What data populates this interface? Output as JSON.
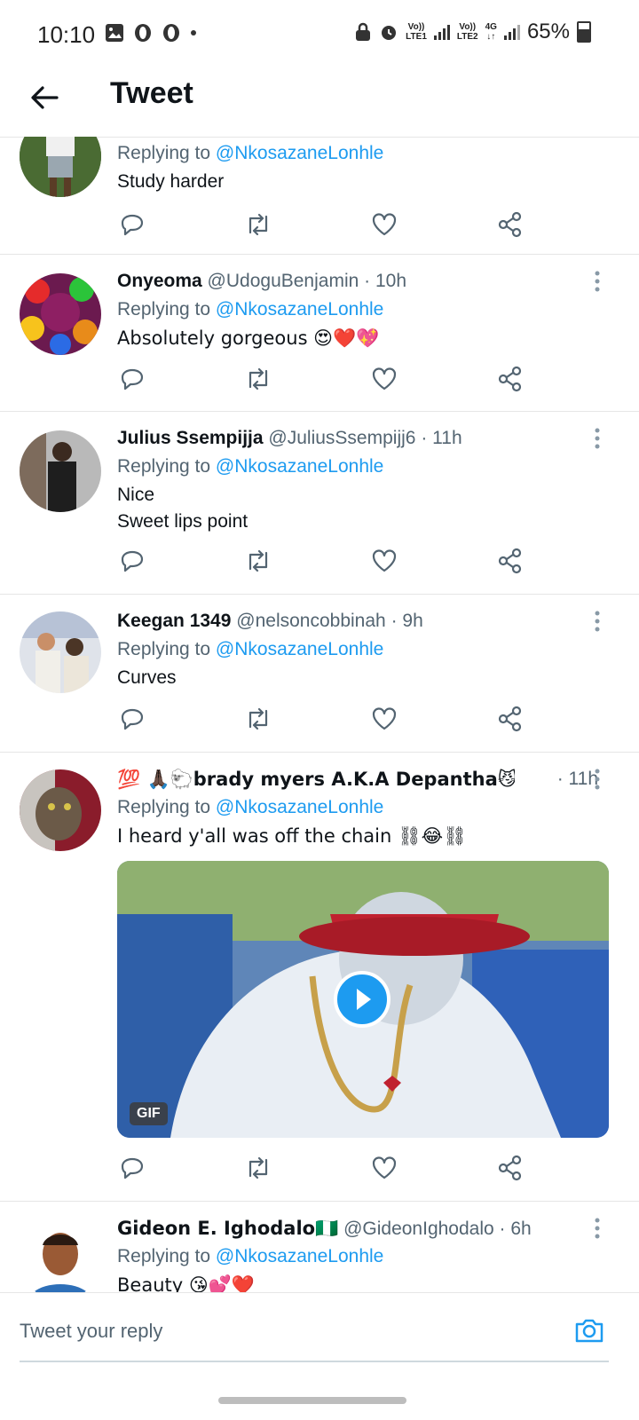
{
  "status_bar": {
    "time": "10:10",
    "net1": [
      "Vo))",
      "LTE1"
    ],
    "net2": [
      "Vo))",
      "LTE2"
    ],
    "net3": "4G",
    "battery": "65%"
  },
  "header": {
    "title": "Tweet"
  },
  "tweets": [
    {
      "name": "",
      "handle": "",
      "time": "",
      "replying_label": "Replying to",
      "replying_to": "@NkosazaneLonhle",
      "text": "Study harder"
    },
    {
      "name": "Onyeoma",
      "handle": "@UdoguBenjamin",
      "time": "· 10h",
      "replying_label": "Replying to",
      "replying_to": "@NkosazaneLonhle",
      "text": "Absolutely gorgeous 😍❤️💖"
    },
    {
      "name": "Julius Ssempijja",
      "handle": "@JuliusSsempijj6",
      "time": "· 11h",
      "replying_label": "Replying to",
      "replying_to": "@NkosazaneLonhle",
      "text": "Nice\nSweet lips point"
    },
    {
      "name": "Keegan 1349",
      "handle": "@nelsoncobbinah",
      "time": "· 9h",
      "replying_label": "Replying to",
      "replying_to": "@NkosazaneLonhle",
      "text": "Curves"
    },
    {
      "name": "💯 🙏🏿🐑brady myers A.K.A Depantha😼♠️...",
      "handle": "",
      "time": "· 11h",
      "replying_label": "Replying to",
      "replying_to": "@NkosazaneLonhle",
      "text": "I heard y'all was off the chain ⛓😂⛓",
      "media_badge": "GIF"
    },
    {
      "name": "Gideon E. Ighodalo🇳🇬",
      "handle": "@GideonIghodalo",
      "time": "· 6h",
      "replying_label": "Replying to",
      "replying_to": "@NkosazaneLonhle",
      "text": "Beauty 😘💕❤️"
    }
  ],
  "compose": {
    "placeholder": "Tweet your reply"
  },
  "colors": {
    "accent": "#1d9bf0",
    "secondary_text": "#536471",
    "divider": "#e6e6e6"
  },
  "icons": [
    "back-arrow-icon",
    "reply-icon",
    "retweet-icon",
    "like-icon",
    "share-icon",
    "more-icon",
    "camera-icon",
    "play-icon"
  ]
}
